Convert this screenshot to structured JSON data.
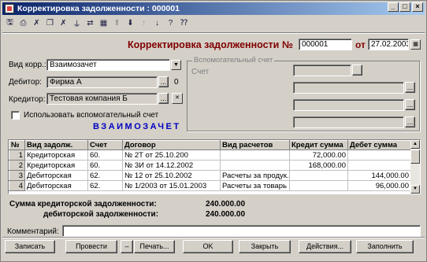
{
  "window": {
    "title": "Корректировка задолженности : 000001"
  },
  "title_buttons": {
    "minimize": "_",
    "maximize": "□",
    "close": "×"
  },
  "toolbar": {
    "icons": [
      "save-doc-icon",
      "print-icon",
      "delete-icon",
      "copy-icon",
      "clear-icon",
      "filter-icon",
      "move-icon",
      "calendar-icon",
      "arrow-up-icon",
      "arrow-down-icon",
      "sort-asc-icon",
      "sort-desc-icon",
      "help-icon",
      "question-icon"
    ],
    "glyphs": [
      "🖫",
      "⎙",
      "✗",
      "❐",
      "✗",
      "⏚",
      "⇄",
      "▦",
      "⬆",
      "⬇",
      "↑",
      "↓",
      "?",
      "⁇"
    ]
  },
  "header": {
    "title": "Корректировка задолженности №",
    "number": "000001",
    "date_label": "от",
    "date": "27.02.2003"
  },
  "form": {
    "vid_label": "Вид корр.:",
    "vid_value": "Взаимозачет",
    "debitor_label": "Дебитор:",
    "debitor_value": "Фирма А",
    "debitor_extra": "0",
    "creditor_label": "Кредитор:",
    "creditor_value": "Тестовая компания Б",
    "checkbox_label": "Использовать вспомогательный счет",
    "mode_text": "ВЗАИМОЗАЧЕТ"
  },
  "aux_group": {
    "title": "Вспомогательный счет",
    "schet_label": "Счет"
  },
  "table": {
    "columns": [
      "№",
      "Вид задолж.",
      "Счет",
      "Договор",
      "Вид расчетов",
      "Кредит сумма",
      "Дебет сумма"
    ],
    "rows": [
      {
        "n": "1",
        "vid": "Кредиторская",
        "schet": "60.",
        "dogovor": "№ 2Т от 25.10.200",
        "vid_r": "",
        "kredit": "72,000.00",
        "debet": ""
      },
      {
        "n": "2",
        "vid": "Кредиторская",
        "schet": "60.",
        "dogovor": "№ 3И от 14.12.2002",
        "vid_r": "",
        "kredit": "168,000.00",
        "debet": ""
      },
      {
        "n": "3",
        "vid": "Дебиторская",
        "schet": "62.",
        "dogovor": "№ 12 от 25.10.2002",
        "vid_r": "Расчеты за продук.",
        "kredit": "",
        "debet": "144,000.00"
      },
      {
        "n": "4",
        "vid": "Дебиторская",
        "schet": "62.",
        "dogovor": "№ 1/2003 от 15.01.2003",
        "vid_r": "Расчеты за товарь",
        "kredit": "",
        "debet": "96,000.00"
      }
    ]
  },
  "sums": {
    "kredit_label": "Сумма кредиторской задолженности:",
    "kredit_value": "240.000.00",
    "debet_label": "дебиторской задолженности:",
    "debet_value": "240.000.00"
  },
  "comment": {
    "label": "Комментарий:",
    "value": ""
  },
  "buttons": {
    "zapisat": "Записать",
    "provesti": "Провести",
    "dash": "–",
    "pechat": "Печать...",
    "ok": "OK",
    "zakryt": "Закрыть",
    "deistvia": "Действия...",
    "zapolnit": "Заполнить"
  }
}
